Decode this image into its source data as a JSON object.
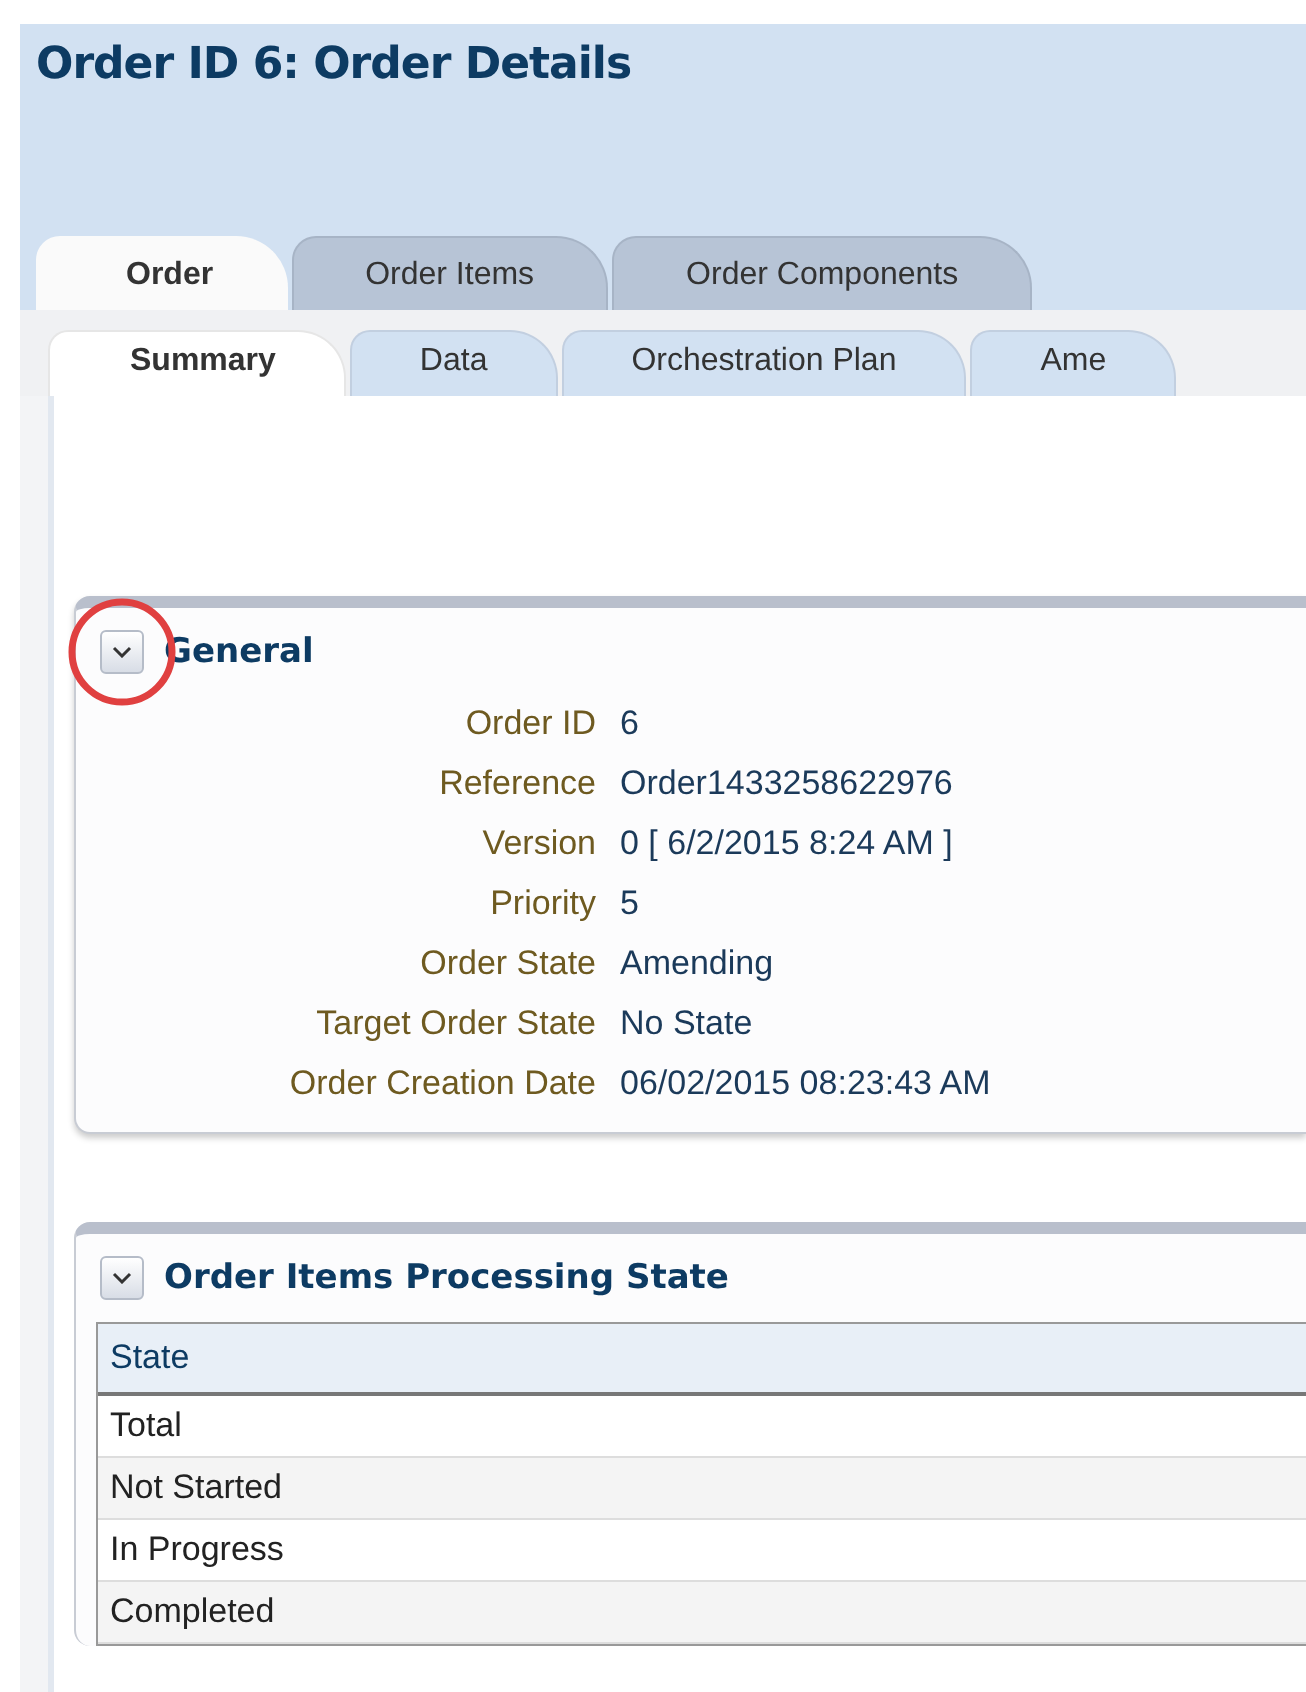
{
  "title": "Order ID 6: Order Details",
  "tabs": [
    {
      "label": "Order",
      "selected": true
    },
    {
      "label": "Order Items",
      "selected": false
    },
    {
      "label": "Order Components",
      "selected": false
    }
  ],
  "subtabs": [
    {
      "label": "Summary",
      "selected": true
    },
    {
      "label": "Data",
      "selected": false
    },
    {
      "label": "Orchestration Plan",
      "selected": false
    },
    {
      "label": "Ame",
      "selected": false
    }
  ],
  "general": {
    "title": "General",
    "expanded": true,
    "annotated": true,
    "fields": [
      {
        "label": "Order ID",
        "value": "6"
      },
      {
        "label": "Reference",
        "value": "Order1433258622976"
      },
      {
        "label": "Version",
        "value": "0  [ 6/2/2015 8:24 AM ]"
      },
      {
        "label": "Priority",
        "value": "5"
      },
      {
        "label": "Order State",
        "value": "Amending"
      },
      {
        "label": "Target Order State",
        "value": "No State"
      },
      {
        "label": "Order Creation Date",
        "value": "06/02/2015 08:23:43 AM"
      }
    ]
  },
  "processing": {
    "title": "Order Items Processing State",
    "expanded": true,
    "table": {
      "columns": [
        "State"
      ],
      "rows": [
        "Total",
        "Not Started",
        "In Progress",
        "Completed"
      ]
    }
  }
}
